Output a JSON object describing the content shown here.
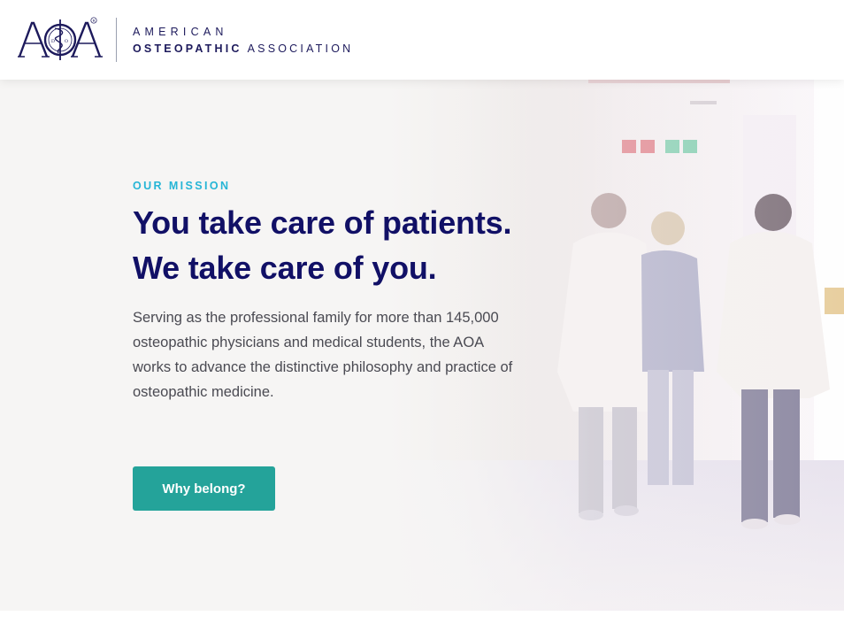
{
  "header": {
    "logo_monogram": "AOA",
    "logo_line1": "AMERICAN",
    "logo_line2_bold": "OSTEOPATHIC",
    "logo_line2_rest": "ASSOCIATION",
    "brand_color": "#1d1a5c"
  },
  "hero": {
    "eyebrow": "OUR MISSION",
    "headline_line1": "You take care of patients.",
    "headline_line2": "We take care of you.",
    "description": "Serving as the professional family for more than 145,000 osteopathic physicians and medical students, the AOA works to advance the distinctive philosophy and practice of osteopathic medicine.",
    "cta_label": "Why belong?",
    "image": "hospital-corridor-medical-staff-photo"
  },
  "colors": {
    "eyebrow": "#26b5d6",
    "headline": "#111066",
    "body_text": "#4a4a52",
    "cta_background": "#24a39a",
    "hero_background": "#f6f5f4"
  }
}
